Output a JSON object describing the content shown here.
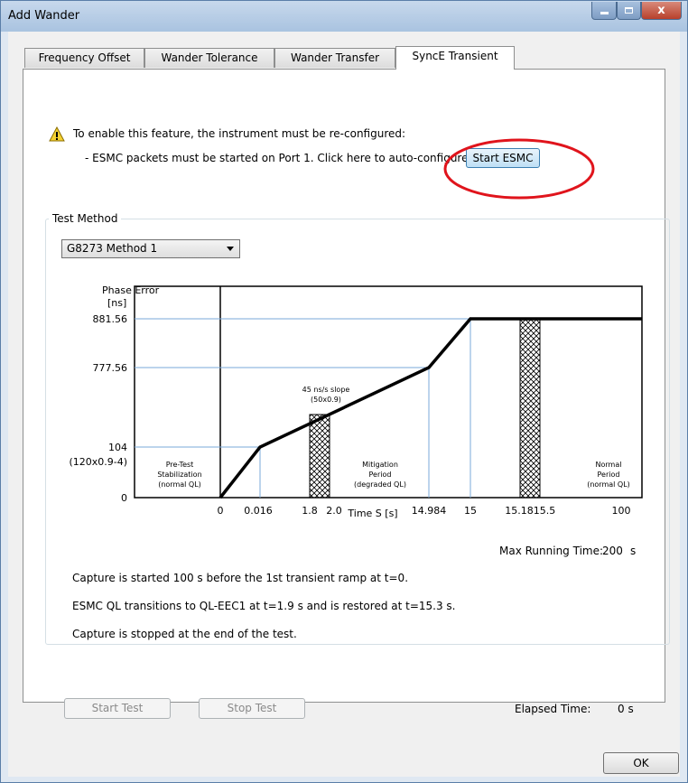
{
  "window": {
    "title": "Add Wander"
  },
  "tabs": [
    {
      "label": "Frequency Offset",
      "active": false
    },
    {
      "label": "Wander Tolerance",
      "active": false
    },
    {
      "label": "Wander Transfer",
      "active": false
    },
    {
      "label": "SyncE Transient",
      "active": true
    }
  ],
  "warning": {
    "line1": "To enable this feature, the instrument must be re-configured:",
    "line2": "- ESMC packets must be started on Port 1. Click here to auto-configure",
    "button_label": "Start ESMC",
    "highlight_color": "#e0141c"
  },
  "test_method": {
    "group_label": "Test Method",
    "selected": "G8273 Method 1"
  },
  "diagram": {
    "y_axis_label_line1": "Phase Error",
    "y_axis_label_line2": "[ns]",
    "y_ticks": [
      "881.56",
      "777.56",
      "104",
      "(120x0.9-4)",
      "0"
    ],
    "x_ticks": [
      "0",
      "0.016",
      "1.8",
      "2.0",
      "14.984",
      "15",
      "15.18",
      "15.5",
      "100"
    ],
    "x_axis_label": "Time S [s]",
    "slope_line1": "45 ns/s slope",
    "slope_line2": "(50x0.9)",
    "region_pretest": [
      "Pre-Test",
      "Stabilization",
      "(normal QL)"
    ],
    "region_mitigation": [
      "Mitigation",
      "Period",
      "(degraded QL)"
    ],
    "region_normal": [
      "Normal",
      "Period",
      "(normal QL)"
    ]
  },
  "max_running_time": {
    "label": "Max Running Time:",
    "value": "200",
    "unit": "s"
  },
  "info_lines": [
    "Capture is started 100 s before the 1st transient ramp at t=0.",
    "ESMC QL transitions to  QL-EEC1  at t=1.9 s and is restored at t=15.3 s.",
    "Capture is stopped at the end of the test."
  ],
  "footer": {
    "start_test": "Start Test",
    "stop_test": "Stop Test",
    "elapsed_label": "Elapsed Time:",
    "elapsed_value": "0 s",
    "ok": "OK"
  }
}
